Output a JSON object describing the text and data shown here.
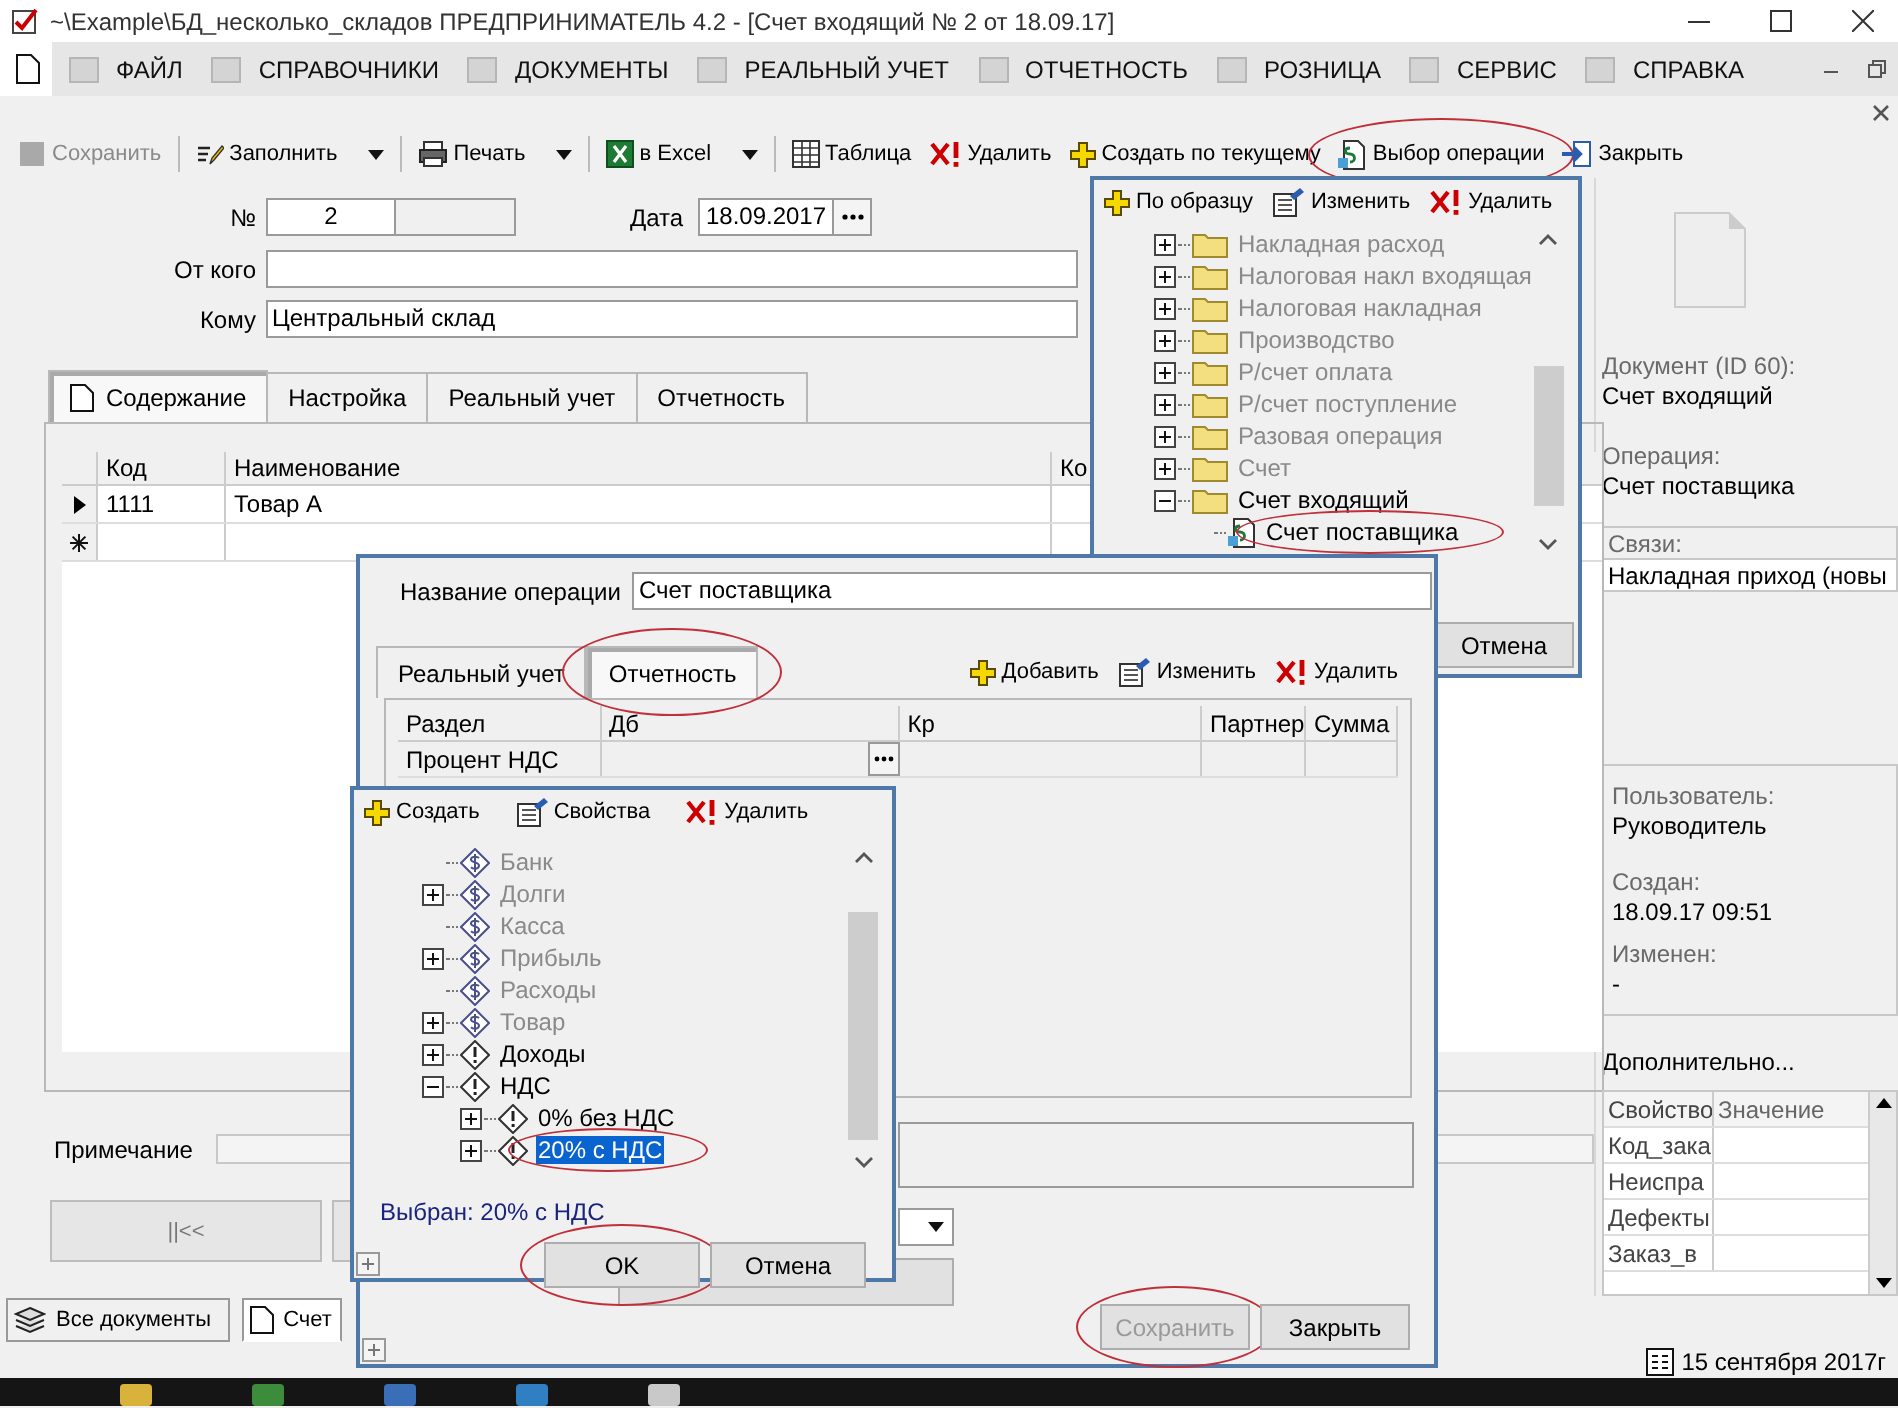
{
  "window": {
    "title": "~\\Example\\БД_несколько_складов  ПРЕДПРИНИМАТЕЛЬ 4.2 - [Счет входящий № 2 от 18.09.17]"
  },
  "menu": [
    {
      "label": "ФАЙЛ"
    },
    {
      "label": "СПРАВОЧНИКИ"
    },
    {
      "label": "ДОКУМЕНТЫ"
    },
    {
      "label": "РЕАЛЬНЫЙ УЧЕТ"
    },
    {
      "label": "ОТЧЕТНОСТЬ"
    },
    {
      "label": "РОЗНИЦА"
    },
    {
      "label": "СЕРВИС"
    },
    {
      "label": "СПРАВКА"
    }
  ],
  "toolbar": [
    {
      "label": "Сохранить",
      "kind": "save",
      "disabled": true,
      "dropdown": false,
      "circled": false
    },
    {
      "label": "Заполнить",
      "kind": "fill",
      "disabled": false,
      "dropdown": true,
      "circled": false
    },
    {
      "label": "Печать",
      "kind": "print",
      "disabled": false,
      "dropdown": true,
      "circled": false
    },
    {
      "label": "в Excel",
      "kind": "excel",
      "disabled": false,
      "dropdown": true,
      "circled": false
    },
    {
      "label": "Таблица",
      "kind": "table",
      "disabled": false,
      "dropdown": false,
      "circled": false
    },
    {
      "label": "Удалить",
      "kind": "delete",
      "disabled": false,
      "dropdown": false,
      "circled": false
    },
    {
      "label": "Создать по текущему",
      "kind": "add",
      "disabled": false,
      "dropdown": false,
      "circled": false
    },
    {
      "label": "Выбор операции",
      "kind": "operation",
      "disabled": false,
      "dropdown": false,
      "circled": true
    },
    {
      "label": "Закрыть",
      "kind": "exit",
      "disabled": false,
      "dropdown": false,
      "circled": false
    }
  ],
  "form": {
    "number_label": "№",
    "number": "2",
    "date_label": "Дата",
    "date": "18.09.2017",
    "from_label": "От кого",
    "to_label": "Кому",
    "to": "Центральный склад"
  },
  "tabs": [
    {
      "label": "Содержание",
      "selected": true
    },
    {
      "label": "Настройка",
      "selected": false
    },
    {
      "label": "Реальный учет",
      "selected": false
    },
    {
      "label": "Отчетность",
      "selected": false
    }
  ],
  "table": {
    "columns": [
      "Код",
      "Наименование",
      "Ко"
    ],
    "rows": [
      {
        "cells": [
          "1111",
          "Товар А"
        ],
        "current": true
      }
    ]
  },
  "note_label": "Примечание",
  "nav_button": "||<<",
  "bottom_tabs": [
    {
      "label": "Все документы",
      "selected": false
    },
    {
      "label": "Счет",
      "selected": true
    }
  ],
  "status_date": "15 сентября 2017г",
  "side_panel": {
    "document_label": "Документ  (ID 60):",
    "document": "Счет входящий",
    "operation_label": "Операция:",
    "operation": "Счет поставщика",
    "links_header": "Связи:",
    "links": [
      "Накладная приход (новы"
    ],
    "user_label": "Пользователь:",
    "user": "Руководитель",
    "created_label": "Создан:",
    "created": "18.09.17  09:51",
    "modified_label": "Изменен:",
    "modified": "-",
    "extra_label": "Дополнительно...",
    "property_columns": [
      "Свойство",
      "Значение"
    ],
    "properties": [
      "Код_зака",
      "Неиспра",
      "Дефекты",
      "Заказ_в"
    ]
  },
  "chooser": {
    "toolbar": [
      {
        "label": "По образцу",
        "kind": "add"
      },
      {
        "label": "Изменить",
        "kind": "edit"
      },
      {
        "label": "Удалить",
        "kind": "delete"
      }
    ],
    "tree": [
      {
        "label": "Накладная расход",
        "kind": "folder",
        "dimmed": true,
        "expandable": true,
        "expanded": false,
        "circled": false
      },
      {
        "label": "Налоговая накл входящая",
        "kind": "folder",
        "dimmed": true,
        "expandable": true,
        "expanded": false,
        "circled": false
      },
      {
        "label": "Налоговая накладная",
        "kind": "folder",
        "dimmed": true,
        "expandable": true,
        "expanded": false,
        "circled": false
      },
      {
        "label": "Производство",
        "kind": "folder",
        "dimmed": true,
        "expandable": true,
        "expanded": false,
        "circled": false
      },
      {
        "label": "Р/счет оплата",
        "kind": "folder",
        "dimmed": true,
        "expandable": true,
        "expanded": false,
        "circled": false
      },
      {
        "label": "Р/счет поступление",
        "kind": "folder",
        "dimmed": true,
        "expandable": true,
        "expanded": false,
        "circled": false
      },
      {
        "label": "Разовая операция",
        "kind": "folder",
        "dimmed": true,
        "expandable": true,
        "expanded": false,
        "circled": false
      },
      {
        "label": "Счет",
        "kind": "folder",
        "dimmed": true,
        "expandable": true,
        "expanded": false,
        "circled": false
      },
      {
        "label": "Счет входящий",
        "kind": "folder",
        "dimmed": false,
        "expandable": true,
        "expanded": true,
        "circled": false,
        "children": [
          {
            "label": "Счет поставщика",
            "kind": "operation",
            "dimmed": false,
            "expandable": false,
            "circled": true
          }
        ]
      }
    ],
    "cancel": "Отмена"
  },
  "operation_dialog": {
    "name_label": "Название операции",
    "name": "Счет поставщика",
    "tabs": [
      {
        "label": "Реальный учет",
        "selected": false,
        "circled": false
      },
      {
        "label": "Отчетность",
        "selected": true,
        "circled": true
      }
    ],
    "toolbar": [
      {
        "label": "Добавить",
        "kind": "add"
      },
      {
        "label": "Изменить",
        "kind": "edit"
      },
      {
        "label": "Удалить",
        "kind": "delete"
      }
    ],
    "columns": [
      "Раздел",
      "Дб",
      "Кр",
      "Партнер",
      "Сумма"
    ],
    "rows": [
      {
        "section": "Процент НДС"
      }
    ],
    "buttons": [
      {
        "label": "Сохранить",
        "disabled": true,
        "circled": true
      },
      {
        "label": "Закрыть",
        "disabled": false,
        "circled": false
      }
    ]
  },
  "account_popup": {
    "toolbar": [
      {
        "label": "Создать",
        "kind": "add"
      },
      {
        "label": "Свойства",
        "kind": "edit"
      },
      {
        "label": "Удалить",
        "kind": "delete"
      }
    ],
    "tree": [
      {
        "label": "Банк",
        "kind": "money",
        "dimmed": true,
        "expandable": false,
        "selected": false,
        "circled": false
      },
      {
        "label": "Долги",
        "kind": "money",
        "dimmed": true,
        "expandable": true,
        "expanded": false,
        "selected": false,
        "circled": false
      },
      {
        "label": "Касса",
        "kind": "money",
        "dimmed": true,
        "expandable": false,
        "selected": false,
        "circled": false
      },
      {
        "label": "Прибыль",
        "kind": "money",
        "dimmed": true,
        "expandable": true,
        "expanded": false,
        "selected": false,
        "circled": false
      },
      {
        "label": "Расходы",
        "kind": "money",
        "dimmed": true,
        "expandable": false,
        "selected": false,
        "circled": false
      },
      {
        "label": "Товар",
        "kind": "money",
        "dimmed": true,
        "expandable": true,
        "expanded": false,
        "selected": false,
        "circled": false
      },
      {
        "label": "Доходы",
        "kind": "alert",
        "dimmed": false,
        "expandable": true,
        "expanded": false,
        "selected": false,
        "circled": false
      },
      {
        "label": "НДС",
        "kind": "alert",
        "dimmed": false,
        "expandable": true,
        "expanded": true,
        "selected": false,
        "circled": false,
        "children": [
          {
            "label": "0% без НДС",
            "kind": "alert",
            "dimmed": false,
            "expandable": true,
            "expanded": false,
            "selected": false,
            "circled": false
          },
          {
            "label": "20% с НДС",
            "kind": "alert",
            "dimmed": false,
            "expandable": true,
            "expanded": false,
            "selected": true,
            "circled": true
          }
        ]
      }
    ],
    "selection": "Выбран:  20% с НДС",
    "buttons": [
      {
        "label": "OK",
        "circled": true
      },
      {
        "label": "Отмена",
        "circled": false
      }
    ]
  }
}
